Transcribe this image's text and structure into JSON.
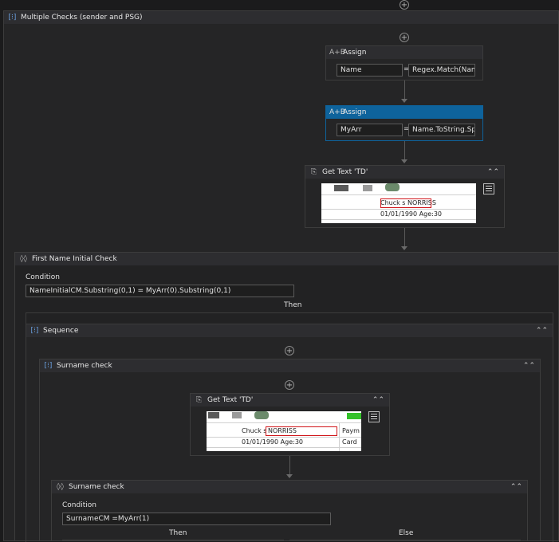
{
  "multiple_checks": {
    "title": "Multiple Checks (sender and PSG)"
  },
  "assign1": {
    "title": "Assign",
    "left": "Name",
    "eq": "=",
    "right": "Regex.Match(Name"
  },
  "assign2": {
    "title": "Assign",
    "left": "MyArr",
    "eq": "=",
    "right": "Name.ToString.Spli"
  },
  "gettext1": {
    "title": "Get Text 'TD'",
    "name_text": "Chuck s NORRISS",
    "dob_text": "01/01/1990 Age:30"
  },
  "first_name_check": {
    "title": "First Name Initial Check",
    "condition_label": "Condition",
    "condition": "NameInitialCM.Substring(0,1) = MyArr(0).Substring(0,1)",
    "then_label": "Then"
  },
  "sequence": {
    "title": "Sequence"
  },
  "surname_check_seq": {
    "title": "Surname check"
  },
  "gettext2": {
    "title": "Get Text 'TD'",
    "name_prefix": "Chuck s",
    "name_highlight": "NORRISS",
    "dob_text": "01/01/1990 Age:30",
    "col2_row1": "Paym",
    "col2_row2": "Card"
  },
  "surname_check_if": {
    "title": "Surname check",
    "condition_label": "Condition",
    "condition": "SurnameCM =MyArr(1)",
    "then_label": "Then",
    "else_label": "Else"
  },
  "colors": {
    "background": "#1b1b1c",
    "panel": "#252526",
    "header": "#2d2d30",
    "selected": "#0e639c",
    "highlight": "#d0161a"
  }
}
